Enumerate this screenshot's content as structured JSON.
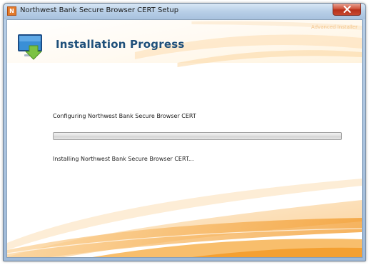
{
  "window": {
    "title": "Northwest Bank Secure Browser CERT Setup",
    "app_icon_letter": "N"
  },
  "header": {
    "title": "Installation Progress",
    "brand": "Advanced Installer"
  },
  "main": {
    "status": "Configuring Northwest Bank Secure Browser CERT",
    "progress_fraction": 0,
    "detail": "Installing Northwest Bank Secure Browser CERT..."
  },
  "colors": {
    "title_text": "#1e4f7a",
    "accent_orange": "#f6a53a",
    "close_button": "#c7482f"
  },
  "icons": {
    "title_icon": "installer-app-icon",
    "header_icon": "monitor-download-icon",
    "close": "close-icon"
  }
}
